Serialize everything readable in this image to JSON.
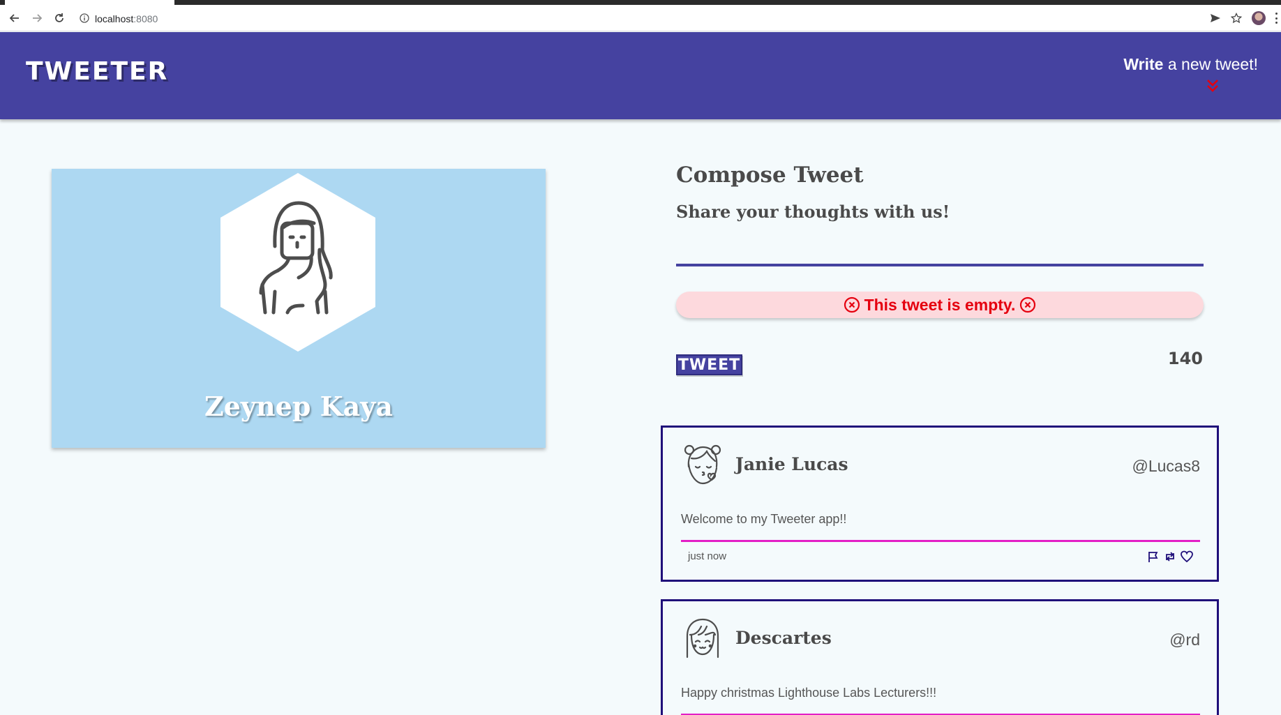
{
  "browser": {
    "url_host": "localhost",
    "url_port": ":8080",
    "icons": [
      "back-arrow-icon",
      "forward-arrow-icon",
      "reload-icon",
      "info-icon",
      "send-icon",
      "star-icon",
      "profile-avatar",
      "menu-kebab-icon"
    ]
  },
  "header": {
    "brand": "TWEETER",
    "write_bold": "Write",
    "write_rest": " a new tweet!",
    "colors": {
      "nav_bg": "#4542a0",
      "chevron": "#e5000f"
    }
  },
  "profile": {
    "name": "Zeynep Kaya",
    "card_bg": "#add8f2"
  },
  "compose": {
    "title": "Compose Tweet",
    "subtitle": "Share your thoughts with us!",
    "textarea_value": "",
    "error": "This tweet is empty.",
    "button": "TWEET",
    "counter": "140",
    "colors": {
      "error_bg": "#fdd9dd",
      "error_text": "#e5000f"
    }
  },
  "tweets": [
    {
      "name": "Janie Lucas",
      "handle": "@Lucas8",
      "body": "Welcome to my Tweeter app!!",
      "time": "just now",
      "avatar_icon": "girl-kiss-avatar-icon"
    },
    {
      "name": "Descartes",
      "handle": "@rd",
      "body": "Happy christmas Lighthouse Labs Lecturers!!!",
      "time": "",
      "avatar_icon": "girl-bangs-avatar-icon"
    }
  ]
}
